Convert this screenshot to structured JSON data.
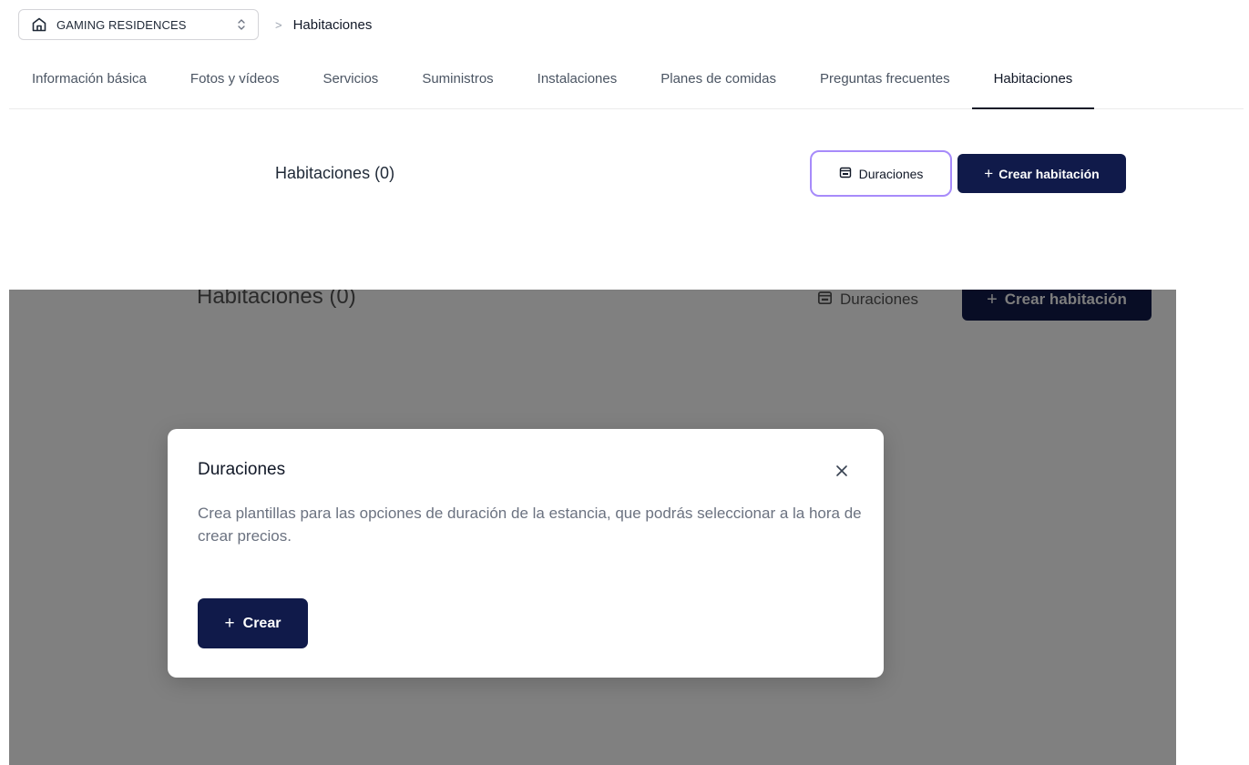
{
  "breadcrumb": {
    "property_name": "GAMING RESIDENCES",
    "separator": ">",
    "current": "Habitaciones"
  },
  "tabs": [
    {
      "label": "Información básica",
      "active": false
    },
    {
      "label": "Fotos y vídeos",
      "active": false
    },
    {
      "label": "Servicios",
      "active": false
    },
    {
      "label": "Suministros",
      "active": false
    },
    {
      "label": "Instalaciones",
      "active": false
    },
    {
      "label": "Planes de comidas",
      "active": false
    },
    {
      "label": "Preguntas frecuentes",
      "active": false
    },
    {
      "label": "Habitaciones",
      "active": true
    }
  ],
  "main": {
    "title": "Habitaciones (0)",
    "durations_button": "Duraciones",
    "create_room_plus": "+",
    "create_room_button": "Crear habitación"
  },
  "modal": {
    "title": "Duraciones",
    "description": "Crea plantillas para las opciones de duración de la estancia, que podrás seleccionar a la hora de crear precios.",
    "create_plus": "+",
    "create_button": "Crear"
  },
  "colors": {
    "primary": "#101a4a",
    "focus_ring": "#a78bfa",
    "overlay": "#808080"
  },
  "icons": {
    "property": "home-icon",
    "selector": "chevron-up-down-icon",
    "durations": "calendar-icon",
    "close": "close-icon"
  }
}
